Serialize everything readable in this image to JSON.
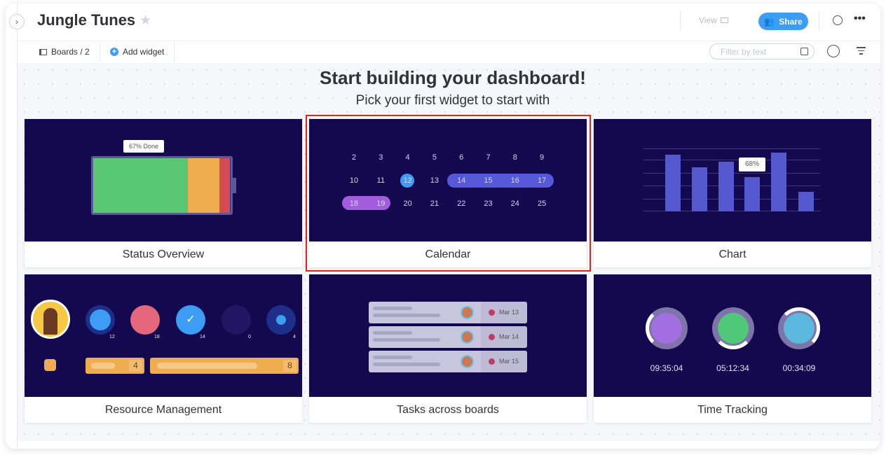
{
  "header": {
    "title": "Jungle Tunes",
    "view_label": "View",
    "share_label": "Share"
  },
  "toolbar": {
    "boards_label": "Boards / 2",
    "add_widget_label": "Add widget",
    "filter_placeholder": "Filter by text"
  },
  "main": {
    "heading": "Start building your dashboard!",
    "subheading": "Pick your first widget to start with"
  },
  "colors": {
    "card_bg": "#14084f",
    "accent": "#3d9cf4",
    "selection": "#e2231a"
  },
  "widgets": [
    {
      "label": "Status Overview",
      "tooltip": "67% Done"
    },
    {
      "label": "Calendar",
      "days": [
        [
          "2",
          "3",
          "4",
          "5",
          "6",
          "7",
          "8",
          "9"
        ],
        [
          "10",
          "11",
          "12",
          "13",
          "14",
          "15",
          "16",
          "17"
        ],
        [
          "18",
          "19",
          "20",
          "21",
          "22",
          "23",
          "24",
          "25"
        ]
      ]
    },
    {
      "label": "Chart",
      "tooltip": "68%",
      "bar_levels": [
        0.9,
        0.7,
        0.79,
        0.54,
        0.93,
        0.31
      ]
    },
    {
      "label": "Resource Management",
      "counts": [
        "12",
        "18",
        "14",
        "0",
        "4"
      ],
      "bars": [
        "4",
        "8"
      ]
    },
    {
      "label": "Tasks across boards",
      "dates": [
        "Mar 13",
        "Mar 14",
        "Mar 15"
      ]
    },
    {
      "label": "Time Tracking",
      "times": [
        "09:35:04",
        "05:12:34",
        "00:34:09"
      ]
    }
  ]
}
